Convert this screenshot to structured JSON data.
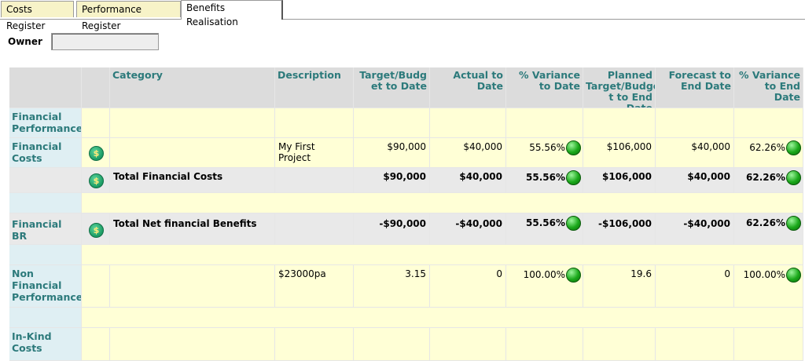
{
  "tabs": [
    {
      "label": "Costs Register"
    },
    {
      "label": "Performance Register"
    },
    {
      "label": "Benefits Realisation"
    }
  ],
  "owner": {
    "label": "Owner",
    "value": ""
  },
  "columns": {
    "category": "Category",
    "description": "Description",
    "target": "Target/Budg et to Date",
    "actual": "Actual to Date",
    "variance_date": "% Variance to Date",
    "planned": "Planned Target/Budge t to End Date",
    "forecast": "Forecast to End Date",
    "variance_end": "% Variance to End Date"
  },
  "rows": {
    "fin_perf": {
      "label": "Financial Performance"
    },
    "fin_costs": {
      "label": "Financial Costs",
      "description": "My First Project",
      "target": "$90,000",
      "actual": "$40,000",
      "var_date": "55.56%",
      "planned": "$106,000",
      "forecast": "$40,000",
      "var_end": "62.26%"
    },
    "total_fin_costs": {
      "category": "Total Financial Costs",
      "target": "$90,000",
      "actual": "$40,000",
      "var_date": "55.56%",
      "planned": "$106,000",
      "forecast": "$40,000",
      "var_end": "62.26%"
    },
    "fin_br": {
      "label": "Financial BR",
      "category": "Total Net financial Benefits",
      "target": "-$90,000",
      "actual": "-$40,000",
      "var_date": "55.56%",
      "planned": "-$106,000",
      "forecast": "-$40,000",
      "var_end": "62.26%"
    },
    "non_fin": {
      "label": "Non Financial Performance",
      "description": "$23000pa",
      "target": "3.15",
      "actual": "0",
      "var_date": "100.00%",
      "planned": "19.6",
      "forecast": "0",
      "var_end": "100.00%"
    },
    "in_kind": {
      "label": "In-Kind Costs"
    }
  },
  "icons": {
    "dollar_glyph": "$",
    "status": "green-status-icon"
  },
  "colors": {
    "header_text": "#2c7a7b",
    "status_green": "#1aa81a",
    "row_yellow": "#ffffd6"
  }
}
